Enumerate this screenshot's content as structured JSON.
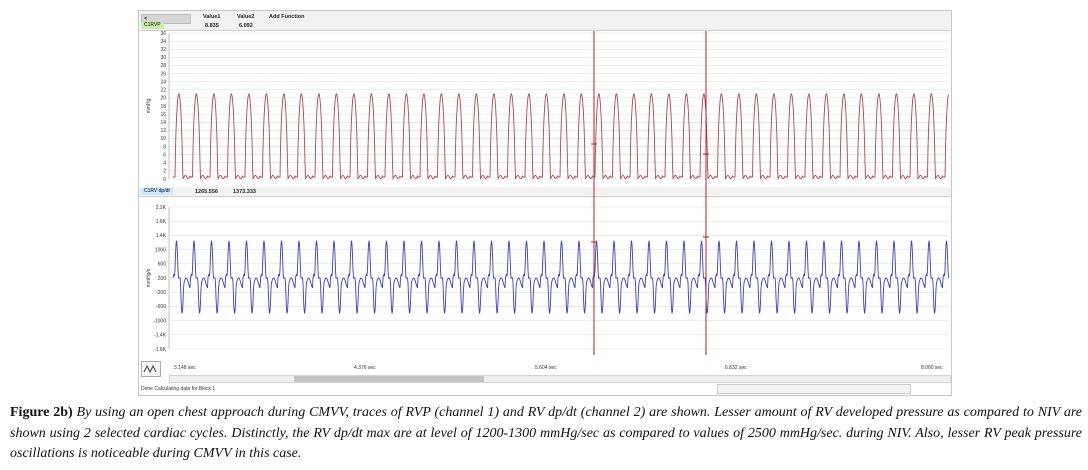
{
  "toolbar": {
    "col1_label": "Value1",
    "col2_label": "Value2",
    "add_function": "Add Function",
    "arrow": "<"
  },
  "channel1": {
    "name": "C1RVP",
    "value1": "8.835",
    "value2": "6.092",
    "unit": "mmHg",
    "ticks": [
      "36",
      "34",
      "32",
      "30",
      "28",
      "26",
      "24",
      "22",
      "20",
      "18",
      "16",
      "14",
      "12",
      "10",
      "8",
      "6",
      "4",
      "2",
      "0"
    ]
  },
  "channel2": {
    "name": "C1RV dp/dt",
    "value1": "1265.556",
    "value2": "1373.333",
    "unit": "mmHg/s",
    "ticks": [
      "2.2K",
      "1.8K",
      "1.4K",
      "1000",
      "600",
      "200",
      "-200",
      "-600",
      "-1000",
      "-1.4K",
      "-1.8K"
    ]
  },
  "time_axis": [
    "3.148 sec",
    "4.376 sec",
    "5.604 sec",
    "6.832 sec",
    "8.060 sec"
  ],
  "status": "Done Calculating data for Block 1",
  "colors": {
    "pressure": "#b5474a",
    "dpdt": "#3b3fc7",
    "cursor": "#c02020",
    "grid": "#d9d9d9",
    "tag1": "#c9f0a6",
    "tag2": "#cde7ff"
  },
  "caption": {
    "label": "Figure 2b)",
    "text": " By using an open chest approach during CMVV, traces of RVP (channel 1) and RV dp/dt (channel 2) are shown. Lesser amount of RV developed pressure as compared to NIV are shown using 2 selected cardiac cycles. Distinctly, the RV dp/dt max are at level of 1200-1300 mmHg/sec as compared to values of 2500 mmHg/sec. during NIV. Also, lesser RV peak pressure oscillations is noticeable during CMVV in this case."
  }
}
